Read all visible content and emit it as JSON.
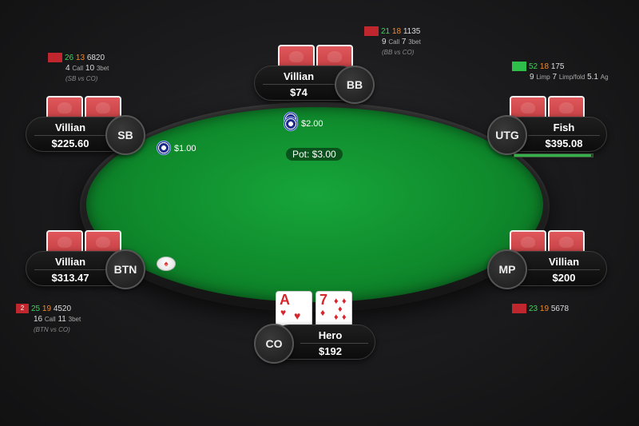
{
  "table": {
    "pot_label": "Pot: $3.00",
    "dealer_button_glyph": "♠"
  },
  "seats": {
    "bb": {
      "name": "Villian",
      "stack": "$74",
      "position": "BB",
      "bet": "$2.00"
    },
    "sb": {
      "name": "Villian",
      "stack": "$225.60",
      "position": "SB",
      "bet": "$1.00"
    },
    "utg": {
      "name": "Fish",
      "stack": "$395.08",
      "position": "UTG",
      "timer_fraction": 0.98
    },
    "btn": {
      "name": "Villian",
      "stack": "$313.47",
      "position": "BTN"
    },
    "mp": {
      "name": "Villian",
      "stack": "$200",
      "position": "MP"
    },
    "co": {
      "name": "Hero",
      "stack": "$192",
      "position": "CO",
      "cards": [
        {
          "rank": "A",
          "suit": "♥"
        },
        {
          "rank": "7",
          "suit": "♦"
        }
      ]
    }
  },
  "huds": {
    "bb": {
      "square_color": "#c0262d",
      "v1": "21",
      "v2": "18",
      "v3": "1135",
      "r2a": "9",
      "r2a_label": "Call",
      "r2b": "7",
      "r2b_label": "3bet",
      "sub": "(BB vs CO)"
    },
    "sb": {
      "square_color": "#c0262d",
      "v1": "26",
      "v2": "13",
      "v3": "6820",
      "r2a": "4",
      "r2a_label": "Call",
      "r2b": "10",
      "r2b_label": "3bet",
      "sub": "(SB vs CO)"
    },
    "utg": {
      "square_color": "#2ebf4a",
      "v1": "52",
      "v2": "18",
      "v3": "175",
      "r2a": "9",
      "r2a_label": "Limp",
      "r2b": "7",
      "r2b_label": "Limp/fold",
      "r2c": "5.1",
      "r2c_label": "Ag"
    },
    "btn": {
      "square_color": "#c0262d",
      "square_text": "2",
      "v1": "25",
      "v2": "19",
      "v3": "4520",
      "r2a": "16",
      "r2a_label": "Call",
      "r2b": "11",
      "r2b_label": "3bet",
      "sub": "(BTN vs CO)"
    },
    "mp": {
      "square_color": "#c0262d",
      "v1": "23",
      "v2": "19",
      "v3": "5678"
    }
  },
  "colors": {
    "felt": "#0f8a2c",
    "card_back": "#d04a4e",
    "hud_green": "#3fd35a",
    "hud_orange": "#f08a2a"
  }
}
